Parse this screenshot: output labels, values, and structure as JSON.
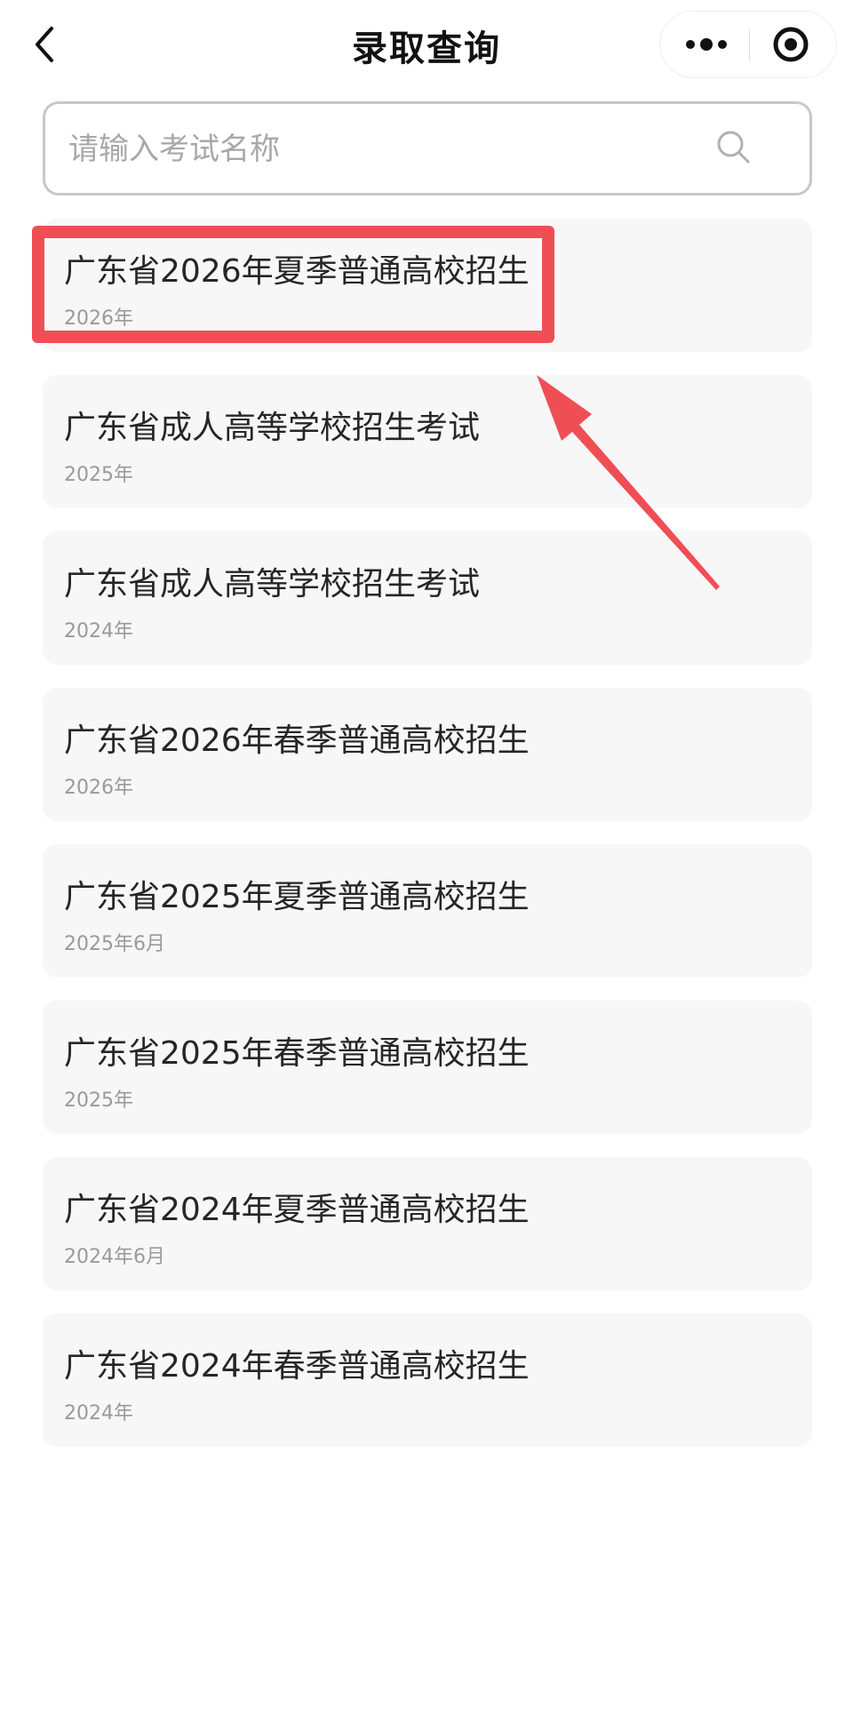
{
  "nav": {
    "title": "录取查询"
  },
  "search": {
    "placeholder": "请输入考试名称",
    "value": ""
  },
  "exams": [
    {
      "title": "广东省2026年夏季普通高校招生",
      "date": "2026年"
    },
    {
      "title": "广东省成人高等学校招生考试",
      "date": "2025年"
    },
    {
      "title": "广东省成人高等学校招生考试",
      "date": "2024年"
    },
    {
      "title": "广东省2026年春季普通高校招生",
      "date": "2026年"
    },
    {
      "title": "广东省2025年夏季普通高校招生",
      "date": "2025年6月"
    },
    {
      "title": "广东省2025年春季普通高校招生",
      "date": "2025年"
    },
    {
      "title": "广东省2024年夏季普通高校招生",
      "date": "2024年6月"
    },
    {
      "title": "广东省2024年春季普通高校招生",
      "date": "2024年"
    }
  ],
  "icons": {
    "back": "chevron-left-icon",
    "more": "more-dots-icon",
    "close": "target-circle-icon",
    "search": "search-icon"
  },
  "colors": {
    "highlight": "#f04e55",
    "card_background": "#f7f7f7",
    "search_border": "#c8c8c8"
  }
}
